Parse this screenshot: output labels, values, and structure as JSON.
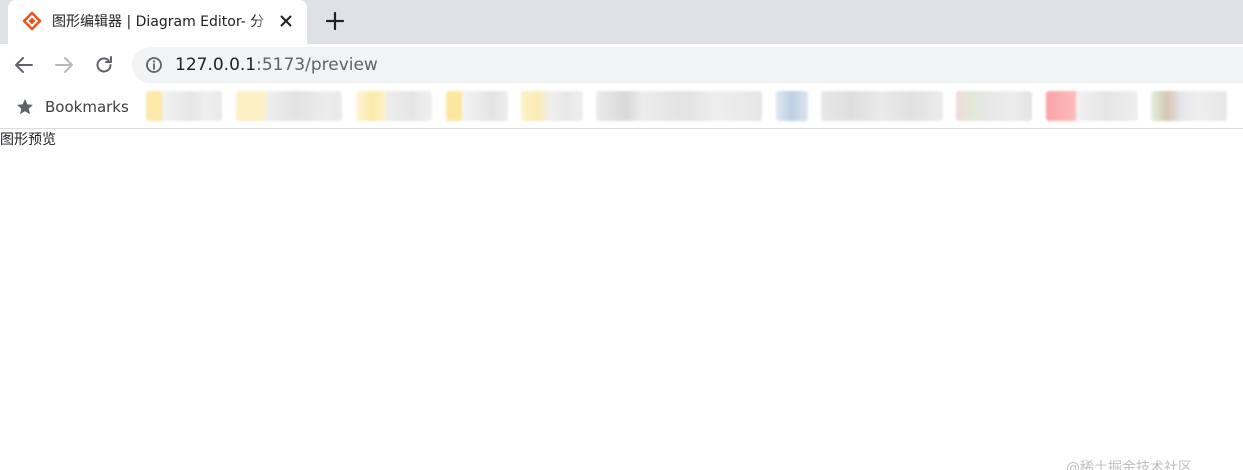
{
  "tab": {
    "title": "图形编辑器 | Diagram Editor- 分",
    "favicon": "diagram-logo-icon"
  },
  "toolbar": {
    "url_host": "127.0.0.1",
    "url_rest": ":5173/preview"
  },
  "bookmarks": {
    "label": "Bookmarks"
  },
  "page": {
    "text": "图形预览"
  },
  "watermark": "@稀土掘金技术社区",
  "colors": {
    "favicon_accent": "#e8541e",
    "tabstrip_bg": "#dee1e6",
    "omnibox_bg": "#f1f3f4"
  }
}
